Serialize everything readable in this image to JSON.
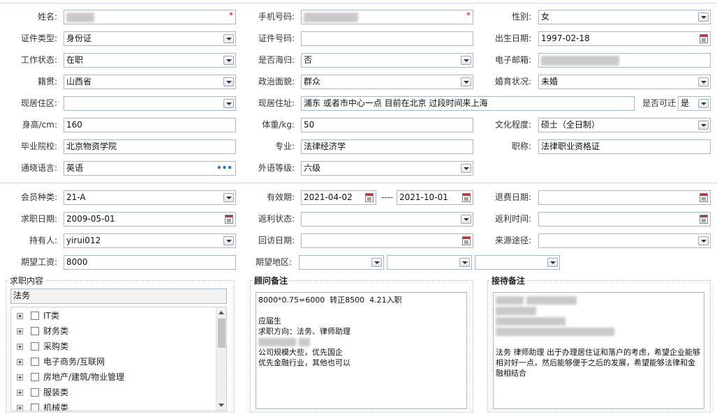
{
  "basic": {
    "name_label": "姓名:",
    "phone_label": "手机号码:",
    "gender_label": "性别:",
    "gender_value": "女",
    "idtype_label": "证件类型:",
    "idtype_value": "身份证",
    "idnum_label": "证件号码:",
    "birth_label": "出生日期:",
    "birth_value": "1997-02-18",
    "workstatus_label": "工作状态:",
    "workstatus_value": "在职",
    "overseas_label": "是否海归:",
    "overseas_value": "否",
    "email_label": "电子邮箱:",
    "native_label": "籍贯:",
    "native_value": "山西省",
    "political_label": "政治面貌:",
    "political_value": "群众",
    "marital_label": "婚育状况:",
    "marital_value": "未婚",
    "district_label": "现居住区:",
    "address_label": "现居住址:",
    "address_value": "浦东 或者市中心一点 目前在北京 过段时间来上海",
    "relocate_label": "是否可迁",
    "relocate_value": "是",
    "height_label": "身高/cm:",
    "height_value": "160",
    "weight_label": "体重/kg:",
    "weight_value": "50",
    "education_label": "文化程度:",
    "education_value": "硕士（全日制）",
    "school_label": "毕业院校:",
    "school_value": "北京物资学院",
    "major_label": "专业:",
    "major_value": "法律经济学",
    "title_label": "职称:",
    "title_value": "法律职业资格证",
    "language_label": "通晓语言:",
    "language_value": "英语",
    "language_more": "•••",
    "langlevel_label": "外语等级:",
    "langlevel_value": "六级"
  },
  "member": {
    "type_label": "会员种类:",
    "type_value": "21-A",
    "valid_label": "有效期:",
    "valid_from": "2021-04-02",
    "valid_sep": "----",
    "valid_to": "2021-10-01",
    "refund_label": "退费日期:",
    "jobdate_label": "求职日期:",
    "jobdate_value": "2009-05-01",
    "rebate_status_label": "返利状态:",
    "rebate_time_label": "返利时间:",
    "holder_label": "持有人:",
    "holder_value": "yirui012",
    "visit_label": "回访日期:",
    "source_label": "来源途径:",
    "salary_label": "期望工资:",
    "salary_value": "8000",
    "region_label": "期望地区:"
  },
  "job": {
    "title": "求职内容",
    "search_value": "法务",
    "categories": [
      "IT类",
      "财务类",
      "采购类",
      "电子商务/互联网",
      "房地产/建筑/物业管理",
      "服装类",
      "机械类"
    ]
  },
  "consultant": {
    "title": "顾问备注",
    "line1": "8000*0.75=6000  转正8500  4.21入职",
    "line2": "应届生",
    "line3": "求职方向：法务、律师助理",
    "line4": "公司规模大些，优先国企",
    "line5": "优先金融行业，其他也可以"
  },
  "reception": {
    "title": "接待备注",
    "text": "法务 律师助理 出于办理居住证和落户的考虑，希望企业能够相对好一点，然后能够便于之后的发展，希望能够法律和金融相结合"
  },
  "colors": {
    "required": "#dd0000",
    "border": "#a9b8c9",
    "link": "#2a6fc9"
  }
}
